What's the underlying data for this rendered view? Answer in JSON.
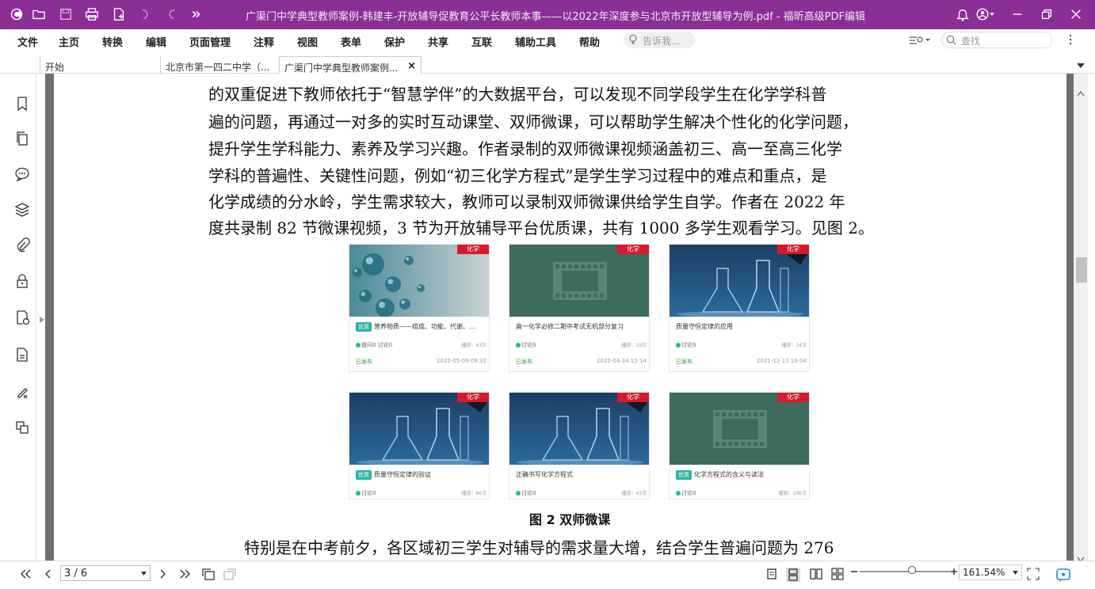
{
  "window": {
    "title": "广渠门中学典型教师案例-韩建丰-开放辅导促教育公平长教师本事——以2022年深度参与北京市开放型辅导为例.pdf - 福昕高级PDF编辑器"
  },
  "menu": {
    "items": [
      "文件",
      "主页",
      "转换",
      "编辑",
      "页面管理",
      "注释",
      "视图",
      "表单",
      "保护",
      "共享",
      "互联",
      "辅助工具",
      "帮助"
    ],
    "tell_me_placeholder": "告诉我...",
    "search_placeholder": "查找"
  },
  "tabs": [
    {
      "label": "开始"
    },
    {
      "label": "北京市第一四二中学（..."
    },
    {
      "label": "广渠门中学典型教师案例...",
      "close": "×"
    }
  ],
  "document": {
    "paragraph_lines": [
      "的双重促进下教师依托于“智慧学伴”的大数据平台，可以发现不同学段学生在化学学科普",
      "遍的问题，再通过一对多的实时互动课堂、双师微课，可以帮助学生解决个性化的化学问题，",
      "提升学生学科能力、素养及学习兴趣。作者录制的双师微课视频涵盖初三、高一至高三化学",
      "学科的普遍性、关键性问题，例如“初三化学方程式”是学生学习过程中的难点和重点，是",
      "化学成绩的分水岭，学生需求较大，教师可以录制双师微课供给学生自学。作者在 2022 年",
      "度共录制 82 节微课视频，3 节为开放辅导平台优质课，共有 1000 多学生观看学习。见图 2。"
    ],
    "figure_caption": "图 2  双师微课",
    "next_line": "特别是在中考前夕，各区域初三学生对辅导的需求量大增，结合学生普遍问题为 276",
    "cards": [
      {
        "tag": "化学",
        "badge": "优质",
        "title": "营养物质——组成、功能、代谢、…",
        "stats": "提问0  讨论0",
        "plays": "播放：63次",
        "status": "已发布",
        "date": "2022-05-09 09:32",
        "thumb": "bubbles"
      },
      {
        "tag": "化学",
        "badge": "",
        "title": "高一化学必修二期中考试无机部分复习",
        "stats": "讨论0",
        "plays": "播放：19次",
        "status": "已发布",
        "date": "2022-04-24 15:14",
        "thumb": "film"
      },
      {
        "tag": "化学",
        "badge": "",
        "title": "质量守恒定律的应用",
        "stats": "讨论0",
        "plays": "播放：34次",
        "status": "已发布",
        "date": "2021-12-13 19:04",
        "thumb": "lab"
      },
      {
        "tag": "化学",
        "badge": "优质",
        "title": "质量守恒定律的验证",
        "stats": "讨论0",
        "plays": "播放：66次",
        "status": "",
        "date": "",
        "thumb": "lab"
      },
      {
        "tag": "化学",
        "badge": "",
        "title": "正确书写化学方程式",
        "stats": "讨论0",
        "plays": "播放：43次",
        "status": "",
        "date": "",
        "thumb": "lab"
      },
      {
        "tag": "化学",
        "badge": "优质",
        "title": "化学方程式的含义与读法",
        "stats": "讨论0",
        "plays": "播放：106次",
        "status": "",
        "date": "",
        "thumb": "film"
      }
    ]
  },
  "status": {
    "page_indicator": "3 / 6",
    "zoom": "161.54%"
  },
  "colors": {
    "titlebar": "#8b2e96",
    "tag_red": "#d61a2b",
    "badge_teal": "#2ab4a3",
    "film_green": "#3d6b5e"
  }
}
